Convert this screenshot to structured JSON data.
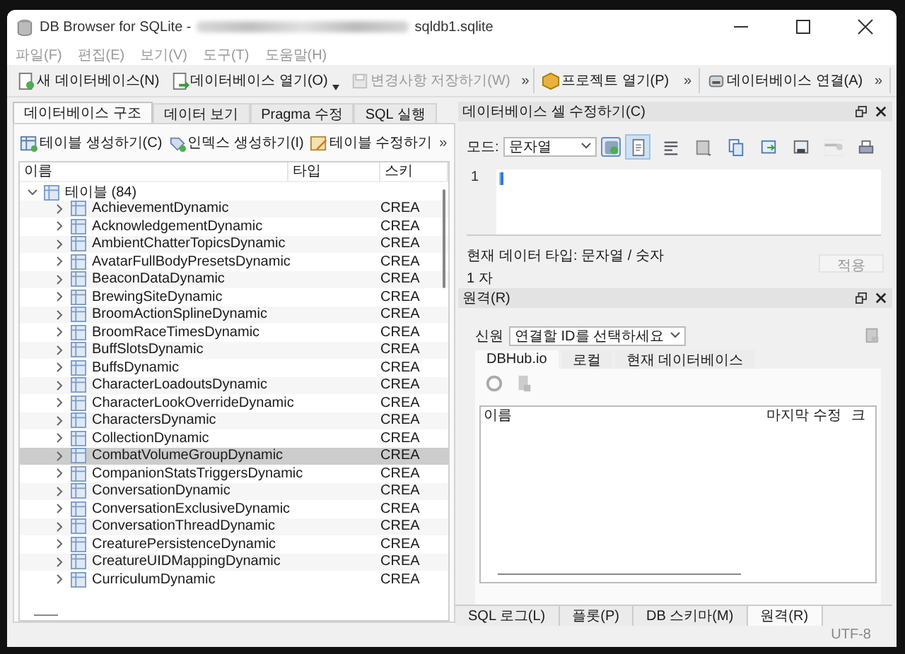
{
  "window": {
    "app_name": "DB Browser for SQLite -",
    "file_name": "sqldb1.sqlite"
  },
  "menu": [
    "파일(F)",
    "편집(E)",
    "보기(V)",
    "도구(T)",
    "도움말(H)"
  ],
  "toolbars": [
    {
      "items": [
        {
          "kind": "new",
          "label": "새 데이터베이스(N)",
          "disabled": false
        },
        {
          "kind": "open",
          "label": "데이터베이스 열기(O)",
          "disabled": false
        },
        {
          "kind": "save",
          "label": "변경사항 저장하기(W)",
          "disabled": true
        }
      ],
      "overflow": "»"
    },
    {
      "items": [
        {
          "kind": "project",
          "label": "프로젝트 열기(P)",
          "disabled": false
        }
      ],
      "overflow": "»"
    },
    {
      "items": [
        {
          "kind": "attach",
          "label": "데이터베이스 연결(A)",
          "disabled": false
        }
      ],
      "overflow": "»"
    }
  ],
  "left_tabs": [
    {
      "label": "데이터베이스 구조",
      "selected": true
    },
    {
      "label": "데이터 보기",
      "selected": false
    },
    {
      "label": "Pragma 수정",
      "selected": false
    },
    {
      "label": "SQL 실행",
      "selected": false
    }
  ],
  "structure_toolbar": {
    "items": [
      {
        "kind": "create-table",
        "label": "테이블 생성하기(C)"
      },
      {
        "kind": "create-index",
        "label": "인덱스 생성하기(I)"
      },
      {
        "kind": "modify-table",
        "label": "테이블 수정하기"
      }
    ],
    "overflow": "»"
  },
  "tree": {
    "columns": [
      "이름",
      "타입",
      "스키"
    ],
    "items": [
      {
        "label": "테이블 (84)",
        "expanded": true,
        "children": [
          {
            "label": "AchievementDynamic",
            "schema": "CREA",
            "selected": false
          },
          {
            "label": "AcknowledgementDynamic",
            "schema": "CREA",
            "selected": false
          },
          {
            "label": "AmbientChatterTopicsDynamic",
            "schema": "CREA",
            "selected": false
          },
          {
            "label": "AvatarFullBodyPresetsDynamic",
            "schema": "CREA",
            "selected": false
          },
          {
            "label": "BeaconDataDynamic",
            "schema": "CREA",
            "selected": false
          },
          {
            "label": "BrewingSiteDynamic",
            "schema": "CREA",
            "selected": false
          },
          {
            "label": "BroomActionSplineDynamic",
            "schema": "CREA",
            "selected": false
          },
          {
            "label": "BroomRaceTimesDynamic",
            "schema": "CREA",
            "selected": false
          },
          {
            "label": "BuffSlotsDynamic",
            "schema": "CREA",
            "selected": false
          },
          {
            "label": "BuffsDynamic",
            "schema": "CREA",
            "selected": false
          },
          {
            "label": "CharacterLoadoutsDynamic",
            "schema": "CREA",
            "selected": false
          },
          {
            "label": "CharacterLookOverrideDynamic",
            "schema": "CREA",
            "selected": false
          },
          {
            "label": "CharactersDynamic",
            "schema": "CREA",
            "selected": false
          },
          {
            "label": "CollectionDynamic",
            "schema": "CREA",
            "selected": false
          },
          {
            "label": "CombatVolumeGroupDynamic",
            "schema": "CREA",
            "selected": true
          },
          {
            "label": "CompanionStatsTriggersDynamic",
            "schema": "CREA",
            "selected": false
          },
          {
            "label": "ConversationDynamic",
            "schema": "CREA",
            "selected": false
          },
          {
            "label": "ConversationExclusiveDynamic",
            "schema": "CREA",
            "selected": false
          },
          {
            "label": "ConversationThreadDynamic",
            "schema": "CREA",
            "selected": false
          },
          {
            "label": "CreaturePersistenceDynamic",
            "schema": "CREA",
            "selected": false
          },
          {
            "label": "CreatureUIDMappingDynamic",
            "schema": "CREA",
            "selected": false
          },
          {
            "label": "CurriculumDynamic",
            "schema": "CREA",
            "selected": false
          }
        ]
      }
    ]
  },
  "cell_editor": {
    "title": "데이터베이스 셀 수정하기(C)",
    "mode_label": "모드:",
    "mode": "문자열",
    "tools": [
      {
        "kind": "text",
        "selected": true
      },
      {
        "kind": "wrap",
        "selected": false
      },
      {
        "kind": "save",
        "selected": false
      },
      {
        "kind": "copy",
        "selected": false
      },
      {
        "kind": "import",
        "selected": false
      },
      {
        "kind": "export",
        "selected": false
      },
      {
        "kind": "null",
        "selected": false
      },
      {
        "kind": "print",
        "selected": false
      }
    ],
    "line_number": "1",
    "data_type": "현재 데이터 타입: 문자열 / 숫자",
    "size": "1 자",
    "apply": "적용",
    "apply_disabled": true
  },
  "remote": {
    "title": "원격(R)",
    "identity_label": "신원",
    "identity": "연결할 ID를 선택하세요",
    "tabs": [
      {
        "label": "DBHub.io",
        "selected": true
      },
      {
        "label": "로컬",
        "selected": false
      },
      {
        "label": "현재 데이터베이스",
        "selected": false
      }
    ],
    "columns": [
      "이름",
      "마지막 수정",
      "크"
    ]
  },
  "bottom_tabs": [
    {
      "label": "SQL 로그(L)",
      "selected": false
    },
    {
      "label": "플롯(P)",
      "selected": false
    },
    {
      "label": "DB 스키마(M)",
      "selected": false
    },
    {
      "label": "원격(R)",
      "selected": true
    }
  ],
  "status_bar": {
    "encoding": "UTF-8"
  }
}
